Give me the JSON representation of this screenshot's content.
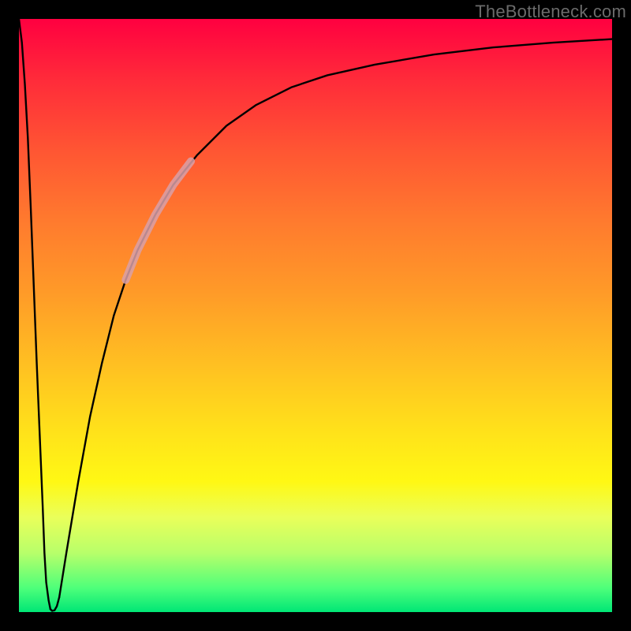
{
  "watermark": "TheBottleneck.com",
  "chart_data": {
    "type": "line",
    "title": "",
    "xlabel": "",
    "ylabel": "",
    "xlim": [
      0,
      100
    ],
    "ylim": [
      0,
      100
    ],
    "grid": false,
    "legend": false,
    "background_gradient": {
      "direction": "top-to-bottom",
      "stops": [
        {
          "pct": 0,
          "color": "#ff0040"
        },
        {
          "pct": 22,
          "color": "#ff5533"
        },
        {
          "pct": 46,
          "color": "#ff9a28"
        },
        {
          "pct": 70,
          "color": "#ffe31a"
        },
        {
          "pct": 84,
          "color": "#eaff5a"
        },
        {
          "pct": 96,
          "color": "#4dff7a"
        },
        {
          "pct": 100,
          "color": "#00e676"
        }
      ]
    },
    "series": [
      {
        "name": "left-drop",
        "stroke": "#000000",
        "stroke_width": 2.4,
        "x": [
          0,
          0.5,
          1,
          1.5,
          2,
          2.5,
          3,
          3.5,
          4,
          4.3,
          4.6,
          5,
          5.3
        ],
        "y": [
          100,
          96,
          89,
          80,
          68,
          55,
          42,
          30,
          18,
          10,
          5,
          2,
          0.5
        ]
      },
      {
        "name": "dip-bottom",
        "stroke": "#000000",
        "stroke_width": 2.4,
        "x": [
          5.3,
          5.6,
          6.0,
          6.4,
          6.8
        ],
        "y": [
          0.5,
          0.2,
          0.3,
          1.0,
          2.5
        ]
      },
      {
        "name": "rising-asymptote",
        "stroke": "#000000",
        "stroke_width": 2.4,
        "x": [
          6.8,
          8,
          10,
          12,
          14,
          16,
          18,
          20,
          23,
          26,
          30,
          35,
          40,
          46,
          52,
          60,
          70,
          80,
          90,
          100
        ],
        "y": [
          2.5,
          10,
          22,
          33,
          42,
          50,
          56,
          61,
          67,
          72,
          77,
          82,
          85.5,
          88.5,
          90.5,
          92.3,
          94,
          95.2,
          96,
          96.6
        ]
      },
      {
        "name": "highlight-segment",
        "stroke": "#d9a0a8",
        "stroke_width": 10,
        "stroke_opacity": 0.85,
        "linecap": "round",
        "x": [
          18,
          20,
          23,
          26,
          29
        ],
        "y": [
          56,
          61,
          67,
          72,
          76
        ]
      }
    ]
  }
}
